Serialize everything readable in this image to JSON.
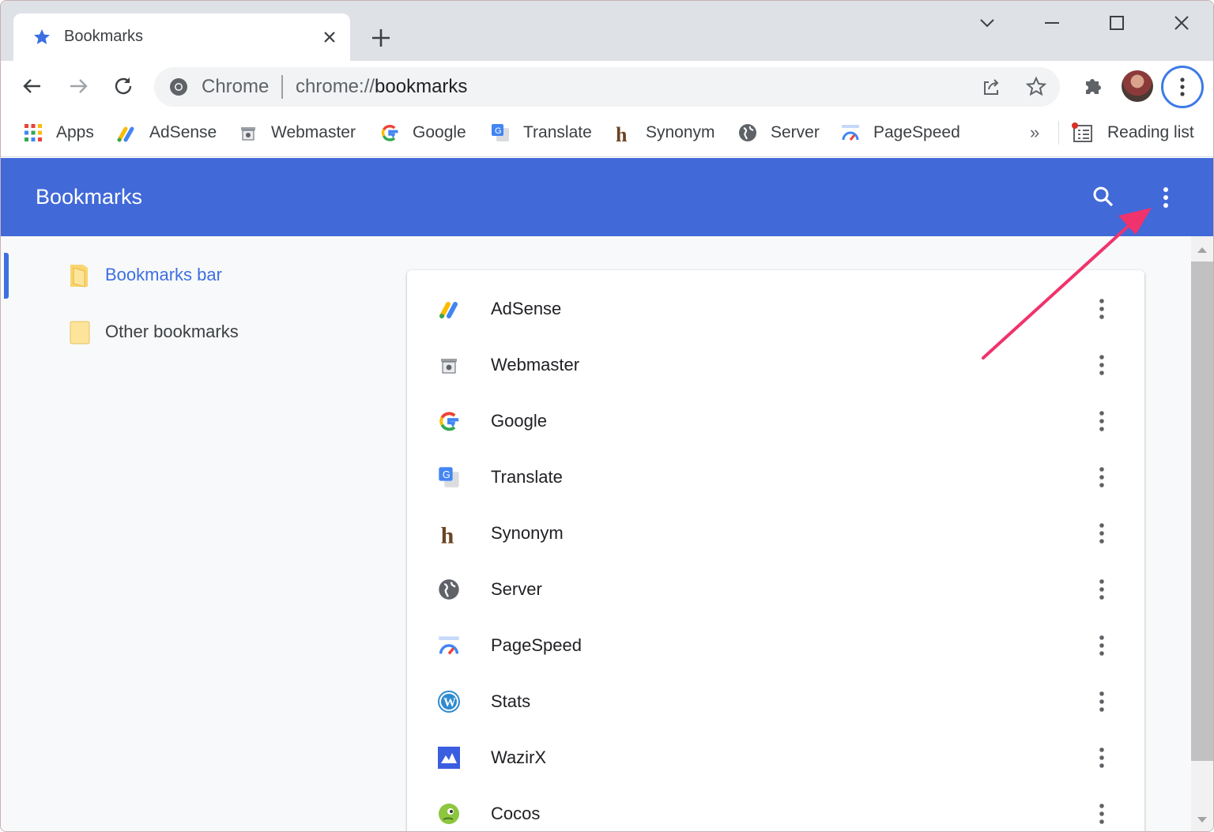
{
  "tab": {
    "title": "Bookmarks"
  },
  "omnibox": {
    "chip": "Chrome",
    "url_scheme": "chrome://",
    "url_path": "bookmarks"
  },
  "bookmarks_bar": {
    "items": [
      {
        "label": "Apps",
        "icon": "apps-grid-icon"
      },
      {
        "label": "AdSense",
        "icon": "adsense-icon"
      },
      {
        "label": "Webmaster",
        "icon": "webmaster-icon"
      },
      {
        "label": "Google",
        "icon": "google-icon"
      },
      {
        "label": "Translate",
        "icon": "translate-icon"
      },
      {
        "label": "Synonym",
        "icon": "synonym-icon"
      },
      {
        "label": "Server",
        "icon": "globe-icon"
      },
      {
        "label": "PageSpeed",
        "icon": "pagespeed-icon"
      }
    ],
    "overflow": "»",
    "reading_list": "Reading list"
  },
  "app": {
    "title": "Bookmarks"
  },
  "sidebar": {
    "folders": [
      {
        "label": "Bookmarks bar",
        "selected": true
      },
      {
        "label": "Other bookmarks",
        "selected": false
      }
    ]
  },
  "list": {
    "rows": [
      {
        "label": "AdSense",
        "icon": "adsense-icon"
      },
      {
        "label": "Webmaster",
        "icon": "webmaster-icon"
      },
      {
        "label": "Google",
        "icon": "google-icon"
      },
      {
        "label": "Translate",
        "icon": "translate-icon"
      },
      {
        "label": "Synonym",
        "icon": "synonym-icon"
      },
      {
        "label": "Server",
        "icon": "globe-icon"
      },
      {
        "label": "PageSpeed",
        "icon": "pagespeed-icon"
      },
      {
        "label": "Stats",
        "icon": "wordpress-icon"
      },
      {
        "label": "WazirX",
        "icon": "wazirx-icon"
      },
      {
        "label": "Cocos",
        "icon": "cocos-icon"
      }
    ]
  },
  "colors": {
    "header_blue": "#4169d8",
    "accent": "#3d6fe0",
    "annotation_arrow": "#f0336c"
  }
}
